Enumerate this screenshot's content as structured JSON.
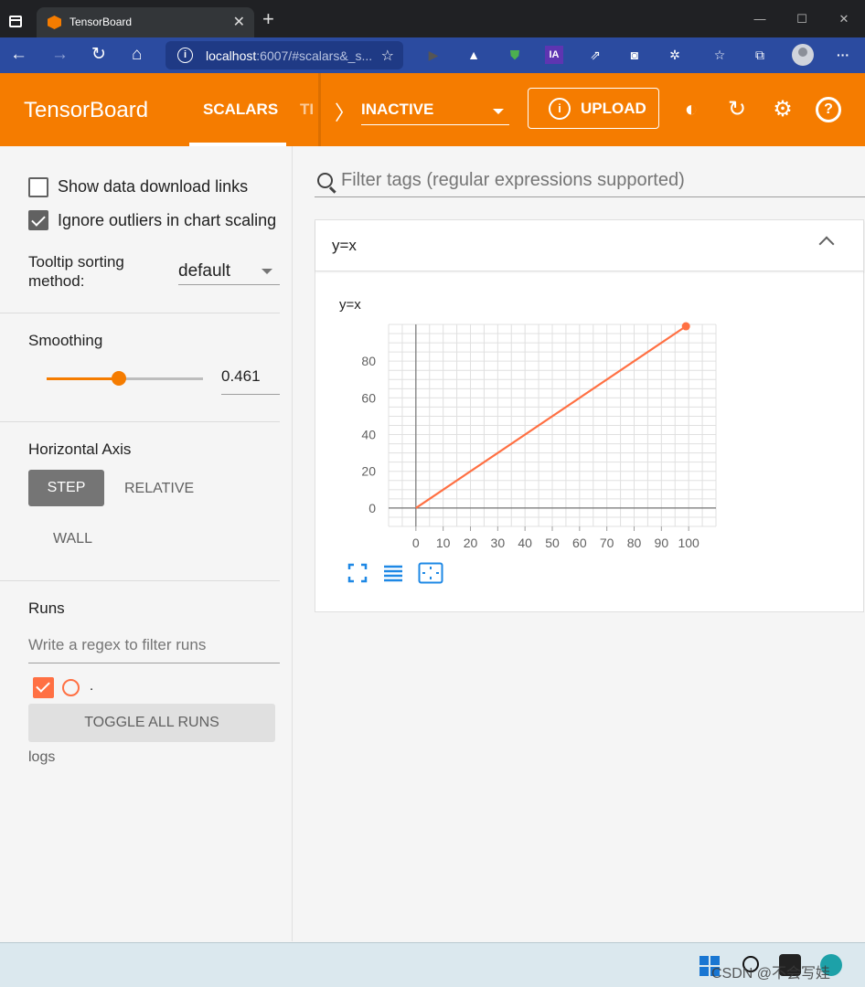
{
  "browser": {
    "tab_title": "TensorBoard",
    "url_host": "localhost",
    "url_rest": ":6007/#scalars&_s..."
  },
  "header": {
    "brand": "TensorBoard",
    "tabs": [
      {
        "label": "SCALARS",
        "active": true
      },
      {
        "label": "TI",
        "active": false
      }
    ],
    "run_selector": "INACTIVE",
    "upload_label": "UPLOAD"
  },
  "sidebar": {
    "show_download_links": {
      "label": "Show data download links",
      "checked": false
    },
    "ignore_outliers": {
      "label": "Ignore outliers in chart scaling",
      "checked": true
    },
    "tooltip_sorting": {
      "label_line1": "Tooltip sorting",
      "label_line2": "method:",
      "value": "default"
    },
    "smoothing": {
      "label": "Smoothing",
      "value": "0.461",
      "fraction": 0.461
    },
    "horizontal_axis": {
      "label": "Horizontal Axis",
      "options": [
        "STEP",
        "RELATIVE",
        "WALL"
      ],
      "selected": "STEP"
    },
    "runs": {
      "label": "Runs",
      "filter_placeholder": "Write a regex to filter runs",
      "items": [
        {
          "name": ".",
          "checked": true
        }
      ],
      "toggle_all": "TOGGLE ALL RUNS",
      "logdir": "logs"
    }
  },
  "main": {
    "filter_placeholder": "Filter tags (regular expressions supported)",
    "card_title": "y=x"
  },
  "chart_data": {
    "type": "line",
    "title": "y=x",
    "x": [
      0,
      99
    ],
    "series": [
      {
        "values": [
          0,
          99
        ],
        "color": "#ff7043"
      }
    ],
    "xlim": [
      -10,
      110
    ],
    "ylim": [
      -10,
      100
    ],
    "xticks": [
      0,
      10,
      20,
      30,
      40,
      50,
      60,
      70,
      80,
      90,
      100
    ],
    "yticks": [
      0,
      20,
      40,
      60,
      80
    ],
    "grid": true
  },
  "taskbar": {
    "watermark": "CSDN @不会写娃"
  },
  "colors": {
    "accent": "#f57c00",
    "series": "#ff7043",
    "nav": "#2b4ba0"
  }
}
